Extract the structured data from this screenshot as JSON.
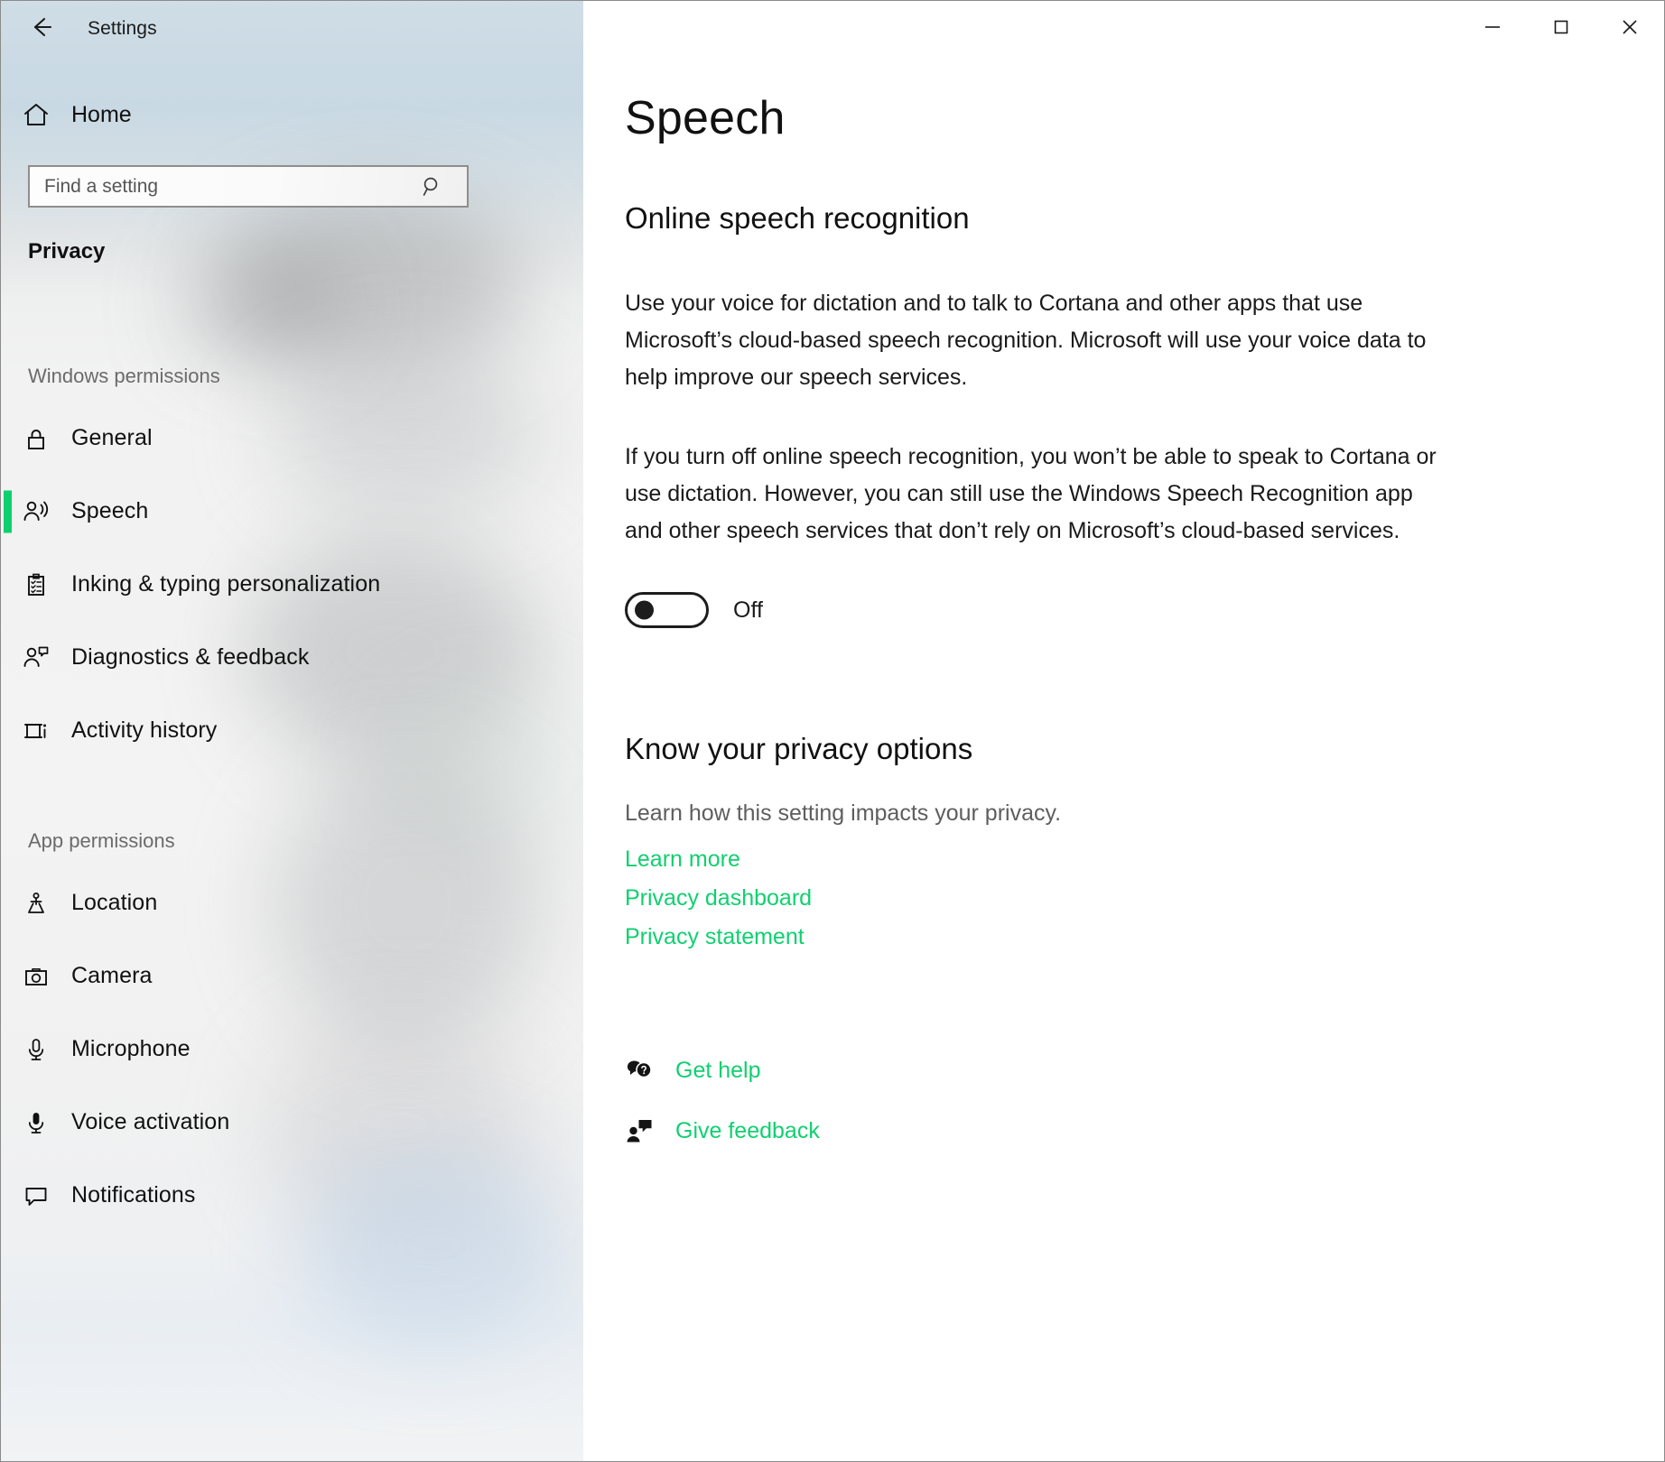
{
  "window": {
    "titlebar": {
      "back_icon": "back-arrow-icon",
      "title": "Settings"
    },
    "controls": {
      "minimize": "minimize-icon",
      "maximize": "maximize-icon",
      "close": "close-icon"
    }
  },
  "sidebar": {
    "home": {
      "label": "Home",
      "icon": "home-icon"
    },
    "search": {
      "placeholder": "Find a setting",
      "value": "",
      "icon": "search-icon"
    },
    "category_title": "Privacy",
    "groups": [
      {
        "header": "Windows permissions",
        "items": [
          {
            "label": "General",
            "icon": "lock-icon",
            "selected": false
          },
          {
            "label": "Speech",
            "icon": "speech-person-icon",
            "selected": true
          },
          {
            "label": "Inking & typing personalization",
            "icon": "clipboard-checklist-icon",
            "selected": false
          },
          {
            "label": "Diagnostics & feedback",
            "icon": "person-feedback-icon",
            "selected": false
          },
          {
            "label": "Activity history",
            "icon": "activity-history-icon",
            "selected": false
          }
        ]
      },
      {
        "header": "App permissions",
        "items": [
          {
            "label": "Location",
            "icon": "location-pin-icon",
            "selected": false
          },
          {
            "label": "Camera",
            "icon": "camera-icon",
            "selected": false
          },
          {
            "label": "Microphone",
            "icon": "microphone-icon",
            "selected": false
          },
          {
            "label": "Voice activation",
            "icon": "microphone-filled-icon",
            "selected": false
          },
          {
            "label": "Notifications",
            "icon": "speech-bubble-icon",
            "selected": false
          }
        ]
      }
    ]
  },
  "content": {
    "page_title": "Speech",
    "section_1": {
      "heading": "Online speech recognition",
      "paragraph_1": "Use your voice for dictation and to talk to Cortana and other apps that use Microsoft’s cloud-based speech recognition. Microsoft will use your voice data to help improve our speech services.",
      "paragraph_2": "If you turn off online speech recognition, you won’t be able to speak to Cortana or use dictation. However, you can still use the Windows Speech Recognition app and other speech services that don’t rely on Microsoft’s cloud-based services.",
      "toggle": {
        "state": "off",
        "label": "Off"
      }
    },
    "section_2": {
      "heading": "Know your privacy options",
      "subtext": "Learn how this setting impacts your privacy.",
      "links": [
        {
          "label": "Learn more"
        },
        {
          "label": "Privacy dashboard"
        },
        {
          "label": "Privacy statement"
        }
      ]
    },
    "footer_links": [
      {
        "label": "Get help",
        "icon": "help-bubbles-icon"
      },
      {
        "label": "Give feedback",
        "icon": "feedback-person-icon"
      }
    ]
  },
  "colors": {
    "accent_green": "#0FD06F",
    "link_green": "#10D070",
    "text_primary": "#111111",
    "text_secondary": "#5E5E5E"
  }
}
